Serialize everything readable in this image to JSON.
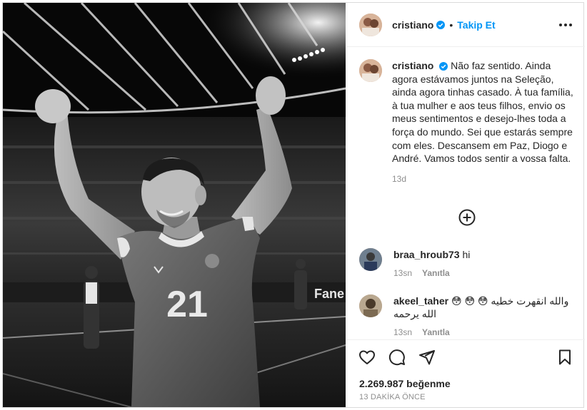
{
  "post": {
    "author": "cristiano",
    "verified_color": "#0095f6",
    "separator": "•",
    "follow_label": "Takip Et",
    "more_icon": "more-options-icon",
    "photo": {
      "jersey_number": "21",
      "sponsor_text": "Fane"
    }
  },
  "caption": {
    "author": "cristiano",
    "text": "Não faz sentido. Ainda agora estávamos juntos na Seleção, ainda agora tinhas casado. À tua família, à tua mulher e aos teus filhos, envio os meus sentimentos e desejo-lhes toda a força do mundo. Sei que estarás sempre com eles. Descansem em Paz, Diogo e André. Vamos todos sentir a vossa falta.",
    "time": "13d"
  },
  "load_more_icon": "plus-circle-icon",
  "comments": [
    {
      "username": "braa_hroub73",
      "text": "hi",
      "time": "13sn",
      "reply_label": "Yanıtla"
    },
    {
      "username": "akeel_taher",
      "text": "والله انقهرت خطيه 😳 😳 😳 الله يرحمه",
      "time": "13sn",
      "reply_label": "Yanıtla"
    }
  ],
  "actions": {
    "like_icon": "heart-icon",
    "comment_icon": "comment-icon",
    "share_icon": "share-icon",
    "save_icon": "bookmark-icon",
    "likes": "2.269.987 beğenme",
    "posted_ago": "13 DAKİKA ÖNCE"
  }
}
